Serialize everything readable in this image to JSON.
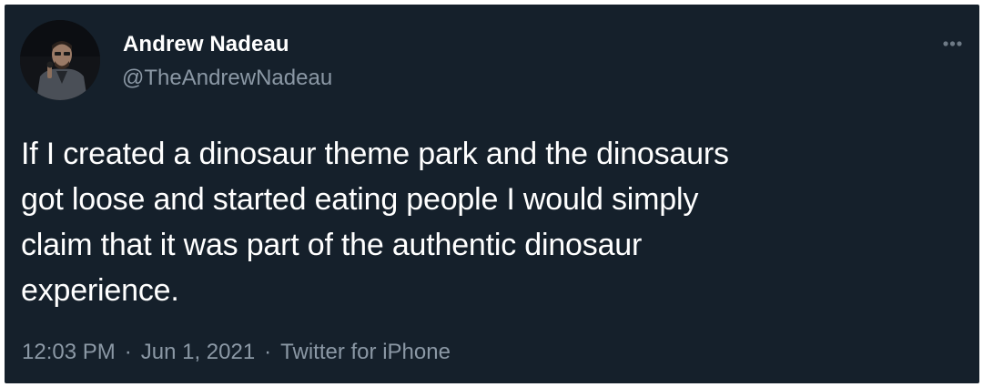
{
  "tweet": {
    "author": {
      "display_name": "Andrew Nadeau",
      "handle": "@TheAndrewNadeau"
    },
    "text_lines": [
      "If I created a dinosaur theme park and the dinosaurs",
      "got loose and started eating people I would simply",
      "claim that it was part of the authentic dinosaur",
      "experience."
    ],
    "time": "12:03 PM",
    "date": "Jun 1, 2021",
    "source": "Twitter for iPhone",
    "separator": "·"
  },
  "icons": {
    "more": "more-horizontal-icon"
  },
  "colors": {
    "background": "#15202b",
    "primary_text": "#ffffff",
    "secondary_text": "#8b98a5"
  }
}
